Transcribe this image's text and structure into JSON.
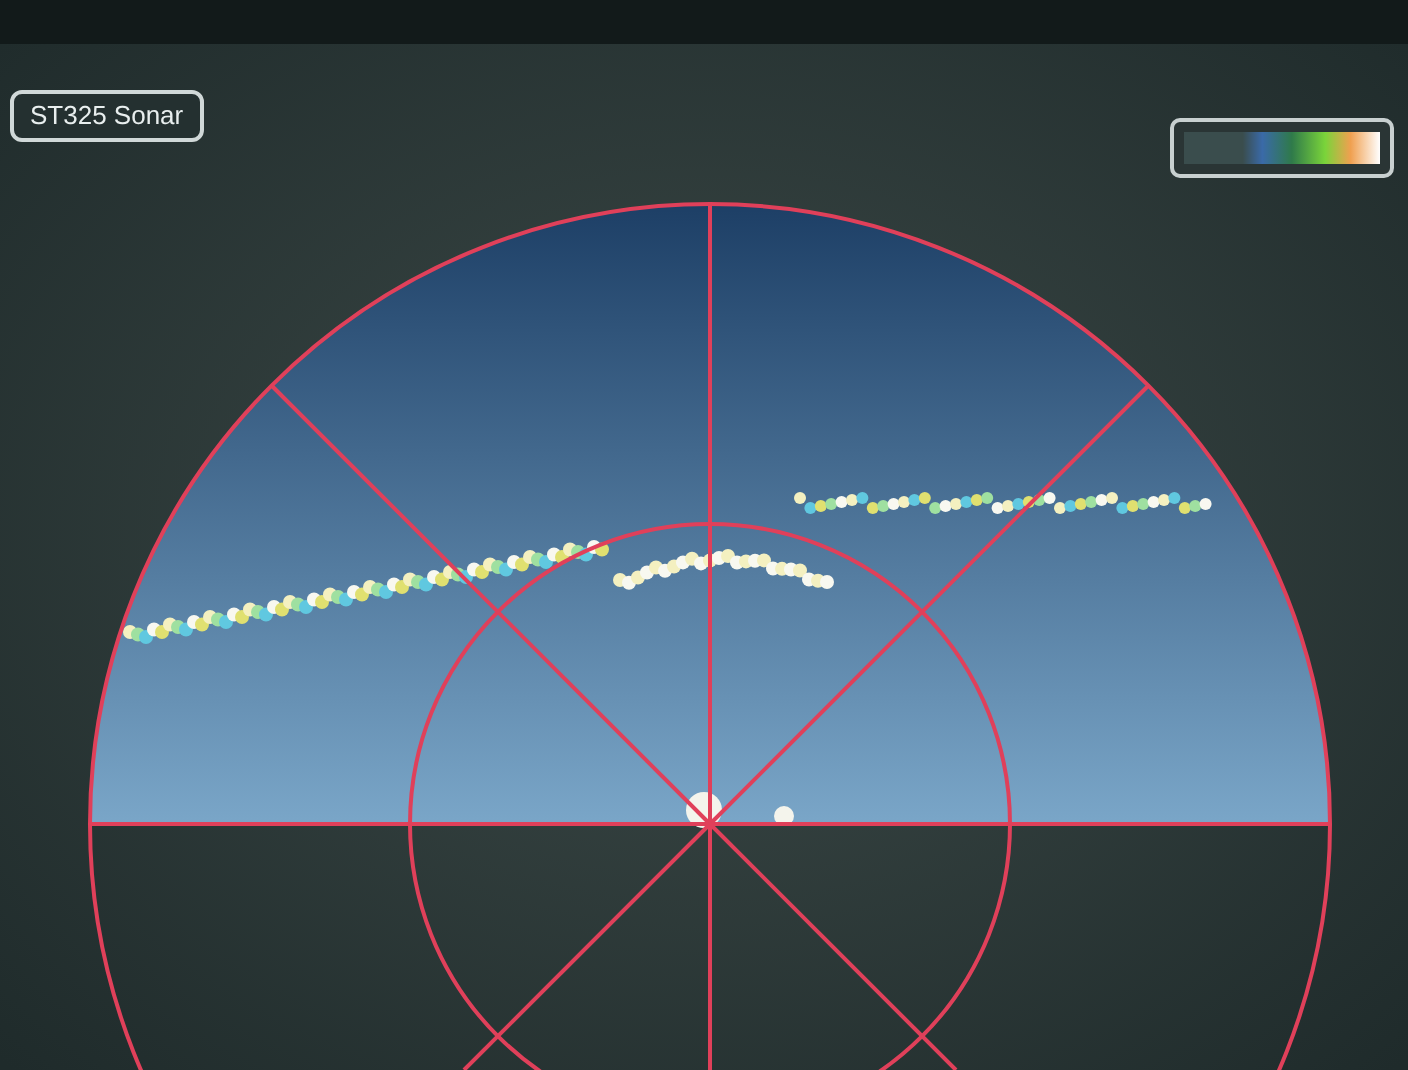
{
  "display": {
    "title": "ST325 Sonar"
  }
}
